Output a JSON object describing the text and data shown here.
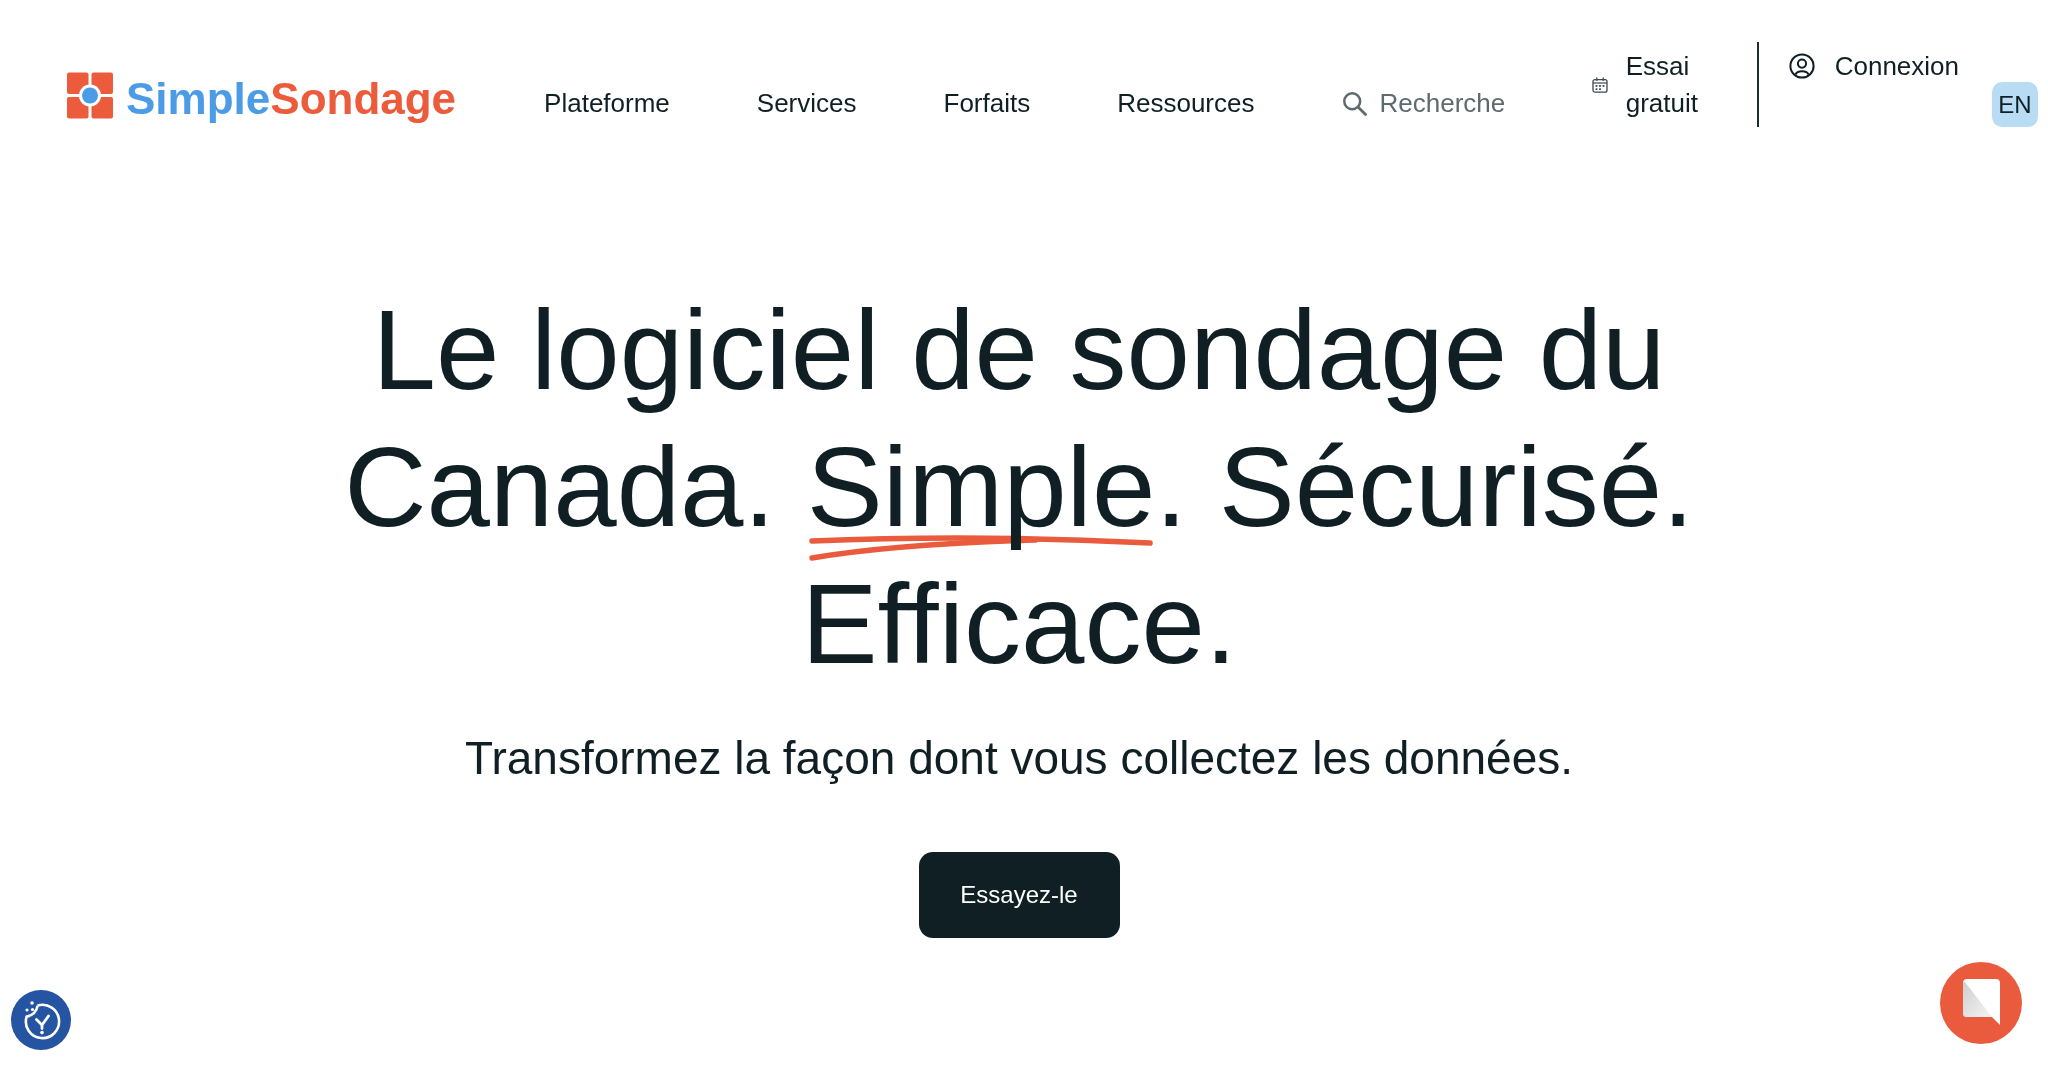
{
  "header": {
    "logo": {
      "first": "Simple",
      "second": "Sondage"
    },
    "nav": [
      {
        "label": "Plateforme"
      },
      {
        "label": "Services"
      },
      {
        "label": "Forfaits"
      },
      {
        "label": "Ressources"
      }
    ],
    "search": {
      "placeholder": "Recherche"
    },
    "trial_link": "Essai gratuit",
    "login_link": "Connexion",
    "language_button": "EN"
  },
  "hero": {
    "headline": {
      "before": "Le logiciel de sondage du Canada. ",
      "highlight": "Simple",
      "after": ". Sécurisé. Efficace."
    },
    "subtitle": "Transformez la façon dont vous collectez les données.",
    "cta_button": "Essayez-le"
  }
}
